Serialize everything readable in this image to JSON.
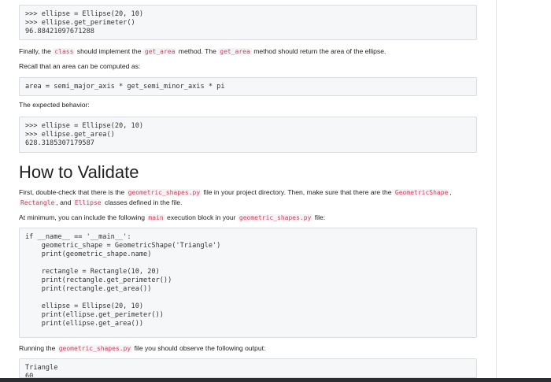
{
  "block1": {
    "lines": [
      ">>> ellipse = Ellipse(20, 10)",
      ">>> ellipse.get_perimeter()",
      "96.88421097671288"
    ]
  },
  "para_finally": {
    "t1": "Finally, the ",
    "c1": "class",
    "t2": " should implement the ",
    "c2": "get_area",
    "t3": " method. The ",
    "c3": "get_area",
    "t4": " method should return the area of the ellipse."
  },
  "para_recall": "Recall that an area can be computed as:",
  "block2": {
    "lines": [
      "area = semi_major_axis * get_semi_minor_axis * pi"
    ]
  },
  "para_expected": "The expected behavior:",
  "block3": {
    "lines": [
      ">>> ellipse = Ellipse(20, 10)",
      ">>> ellipse.get_area()",
      "628.3185307179587"
    ]
  },
  "heading": "How to Validate",
  "para_first": {
    "t1": "First, double-check that there is the ",
    "c1": "geometric_shapes.py",
    "t2": " file in your project directory. Then, make sure that there are the ",
    "c2": "GeometricShape",
    "t3": ",",
    "c3": "Rectangle",
    "t4": ", and ",
    "c4": "Ellipse",
    "t5": " classes defined in the file."
  },
  "para_minimum": {
    "t1": "At minimum, you can include the following ",
    "c1": "main",
    "t2": " execution block in your ",
    "c2": "geometric_shapes.py",
    "t3": " file:"
  },
  "block4": {
    "lines": [
      "if __name__ == '__main__':",
      "    geometric_shape = GeometricShape('Triangle')",
      "    print(geometric_shape.name)",
      "",
      "    rectangle = Rectangle(10, 20)",
      "    print(rectangle.get_perimeter())",
      "    print(rectangle.get_area())",
      "",
      "    ellipse = Ellipse(20, 10)",
      "    print(ellipse.get_perimeter())",
      "    print(ellipse.get_area())"
    ]
  },
  "para_running": {
    "t1": "Running the ",
    "c1": "geometric_shapes.py",
    "t2": " file you should observe the following output:"
  },
  "block5": {
    "lines": [
      "Triangle",
      "60"
    ]
  }
}
